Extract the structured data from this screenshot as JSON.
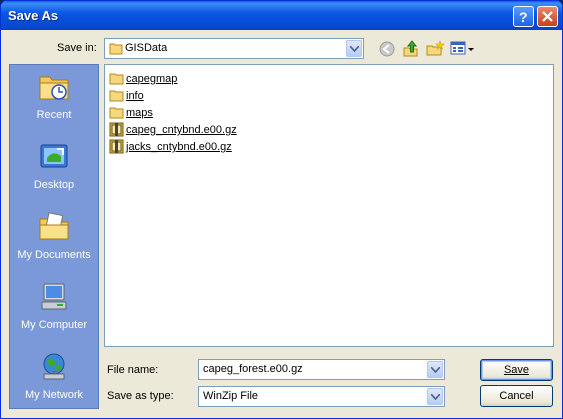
{
  "window": {
    "title": "Save As"
  },
  "savein": {
    "label": "Save in:",
    "value": "GISData"
  },
  "places": [
    {
      "label": "Recent",
      "icon": "recent-folder-icon"
    },
    {
      "label": "Desktop",
      "icon": "desktop-icon"
    },
    {
      "label": "My Documents",
      "icon": "my-documents-icon"
    },
    {
      "label": "My Computer",
      "icon": "my-computer-icon"
    },
    {
      "label": "My Network",
      "icon": "my-network-icon"
    }
  ],
  "files": [
    {
      "name": "capegmap",
      "type": "folder"
    },
    {
      "name": "info",
      "type": "folder"
    },
    {
      "name": "maps",
      "type": "folder"
    },
    {
      "name": "capeg_cntybnd.e00.gz",
      "type": "winzip"
    },
    {
      "name": "jacks_cntybnd.e00.gz",
      "type": "winzip"
    }
  ],
  "filename": {
    "label": "File name:",
    "value": "capeg_forest.e00.gz"
  },
  "filetype": {
    "label": "Save as type:",
    "value": "WinZip File"
  },
  "buttons": {
    "save": "Save",
    "cancel": "Cancel"
  },
  "colors": {
    "titlebar": "#0b58e3",
    "places_bg": "#7b98d8",
    "dialog_bg": "#ece9d8"
  }
}
